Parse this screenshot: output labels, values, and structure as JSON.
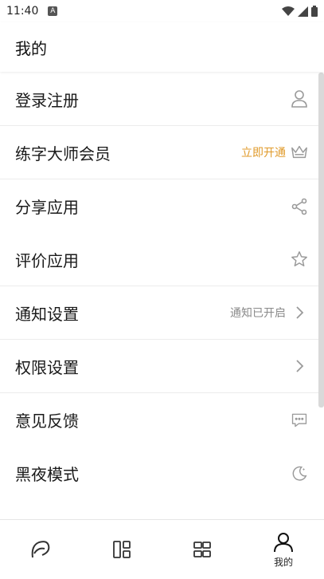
{
  "status_bar": {
    "time": "11:40",
    "notification_badge": "A"
  },
  "header": {
    "title": "我的"
  },
  "menu": {
    "items": [
      {
        "label": "登录注册",
        "hint": "",
        "icon": "user-icon"
      },
      {
        "label": "练字大师会员",
        "hint": "立即开通",
        "icon": "crown-icon"
      },
      {
        "label": "分享应用",
        "hint": "",
        "icon": "share-icon"
      },
      {
        "label": "评价应用",
        "hint": "",
        "icon": "star-icon"
      },
      {
        "label": "通知设置",
        "hint": "通知已开启",
        "icon": "chevron-right-icon"
      },
      {
        "label": "权限设置",
        "hint": "",
        "icon": "chevron-right-icon"
      },
      {
        "label": "意见反馈",
        "hint": "",
        "icon": "feedback-icon"
      },
      {
        "label": "黑夜模式",
        "hint": "",
        "icon": "moon-icon"
      }
    ]
  },
  "tabbar": {
    "tabs": [
      {
        "label": "",
        "icon": "brush-icon"
      },
      {
        "label": "",
        "icon": "layout-icon"
      },
      {
        "label": "",
        "icon": "grid-icon"
      },
      {
        "label": "我的",
        "icon": "profile-icon"
      }
    ]
  },
  "colors": {
    "accent": "#e09a2a",
    "hint": "#8a8a8a",
    "icon": "#9a9a9a"
  }
}
